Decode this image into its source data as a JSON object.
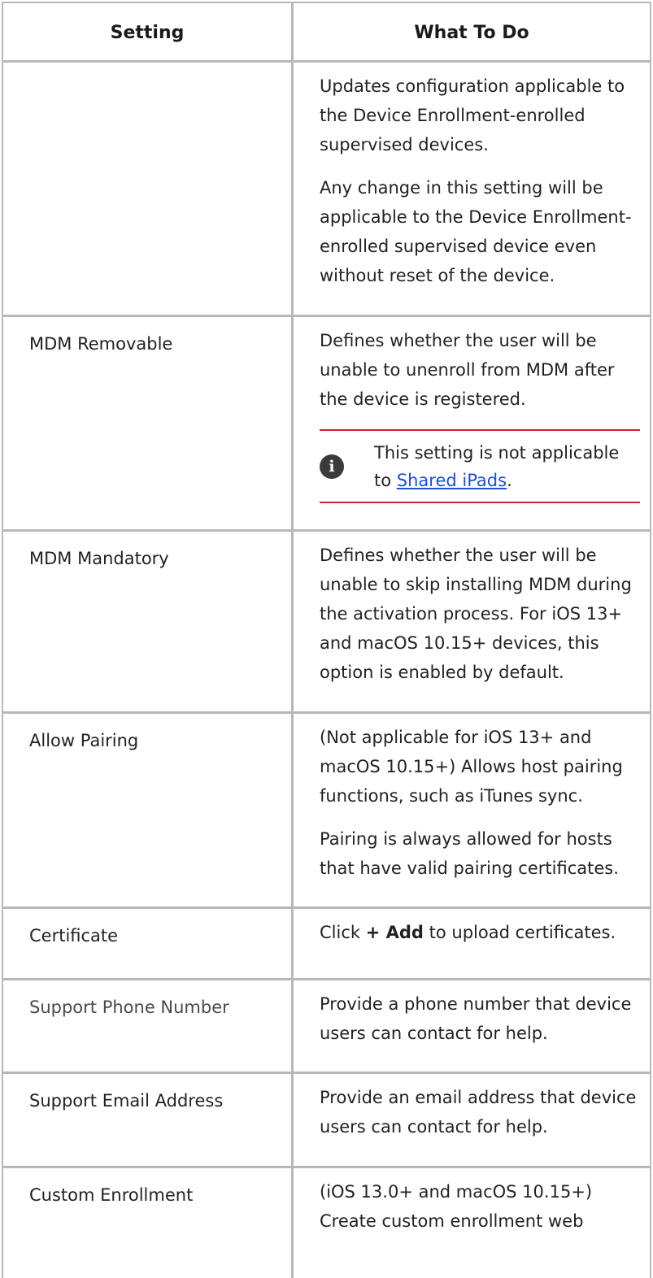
{
  "table": {
    "header": {
      "setting": "Setting",
      "what_to_do": "What To Do"
    },
    "cont_row": {
      "p1": "Updates configuration applicable to the Device Enrollment-enrolled supervised devices.",
      "p2": "Any change in this setting will be applicable to the Device Enrollment-enrolled supervised device even without reset of the device."
    },
    "mdm_removable": {
      "setting": "MDM Removable",
      "desc": "Defines whether the user will be unable to unenroll from MDM after the device is registered.",
      "note_prefix": "This setting is not applicable to ",
      "note_link": "Shared iPads",
      "note_suffix": "."
    },
    "mdm_mandatory": {
      "setting": "MDM Mandatory",
      "desc": "Defines whether the user will be unable to skip installing MDM during the activation process. For iOS 13+ and macOS 10.15+ devices, this option is enabled by default."
    },
    "allow_pairing": {
      "setting": "Allow Pairing",
      "p1": "(Not applicable for iOS 13+ and macOS 10.15+) Allows host pairing functions, such as iTunes sync.",
      "p2": "Pairing is always allowed for hosts that have valid pairing certificates."
    },
    "certificate": {
      "setting": "Certificate",
      "desc_prefix": "Click ",
      "desc_bold": "+ Add",
      "desc_suffix": " to upload certificates."
    },
    "support_phone": {
      "setting": "Support Phone Number",
      "desc": "Provide a phone number that device users can contact for help."
    },
    "support_email": {
      "setting": "Support Email Address",
      "desc": "Provide an email address that device users can contact for help."
    },
    "custom_enrollment": {
      "setting": "Custom Enrollment",
      "desc": "(iOS 13.0+ and macOS 10.15+) Create custom enrollment web"
    }
  },
  "colors": {
    "border": "#b8b8b8",
    "note_rule": "#d0202c",
    "link": "#1a4fd6"
  },
  "icons": {
    "note": "info-icon"
  }
}
